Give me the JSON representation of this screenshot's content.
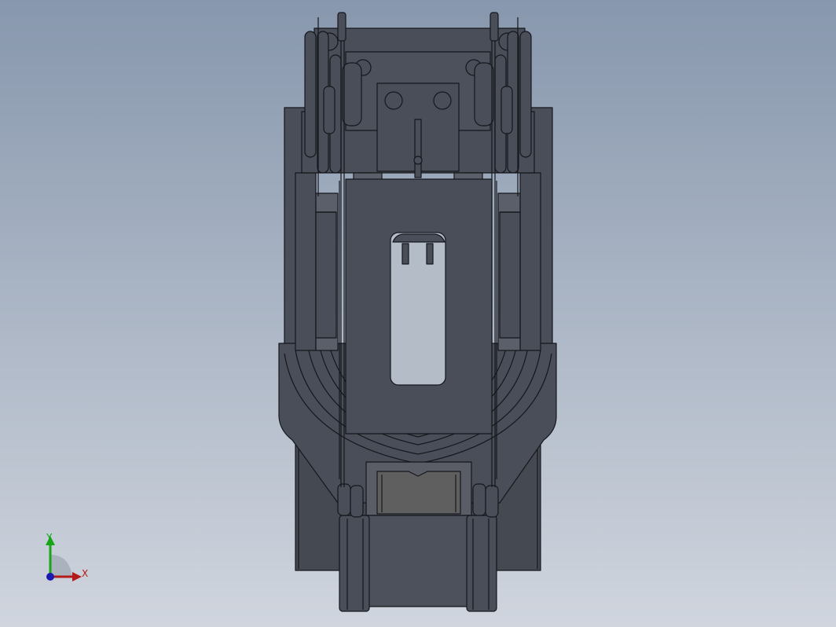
{
  "viewport": {
    "background_top": "#8797ad",
    "background_bottom": "#d0d5de",
    "model_fill": "#4a4e58",
    "model_fill_light": "#5b5f6a",
    "model_edge": "#15171c",
    "pocket_fill": "#b4bcc8",
    "clamp_fill": "#5f5f5f"
  },
  "triad": {
    "y_label": "Y",
    "x_label": "X",
    "y_color": "#17a617",
    "x_color": "#b31a1a",
    "z_color": "#1a1ab3"
  }
}
